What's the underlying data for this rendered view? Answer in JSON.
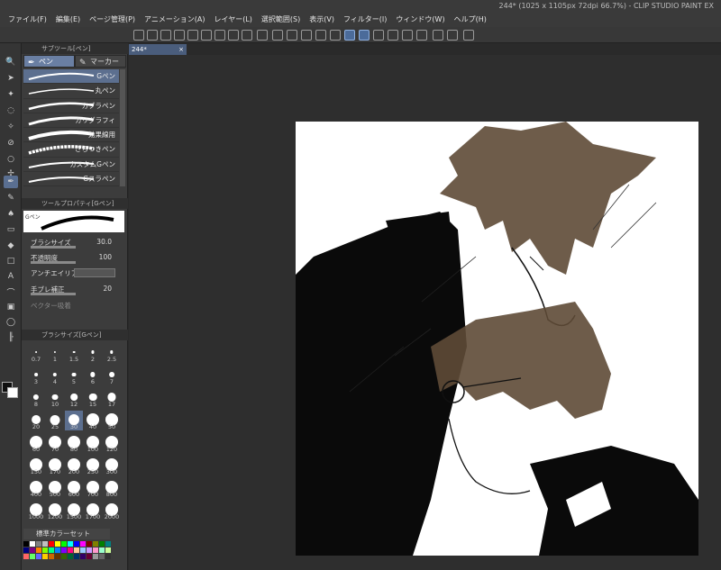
{
  "window": {
    "title": "244* (1025 x 1105px 72dpi 66.7%) - CLIP STUDIO PAINT EX"
  },
  "menu": [
    "ファイル(F)",
    "編集(E)",
    "ページ管理(P)",
    "アニメーション(A)",
    "レイヤー(L)",
    "選択範囲(S)",
    "表示(V)",
    "フィルター(I)",
    "ウィンドウ(W)",
    "ヘルプ(H)"
  ],
  "subtool_panel": {
    "header": "サブツール[ペン]",
    "tabs": [
      {
        "label": "ペン",
        "icon": "pen-icon",
        "active": true
      },
      {
        "label": "マーカー",
        "icon": "marker-icon",
        "active": false
      }
    ],
    "brushes": [
      {
        "name": "Gペン",
        "active": true
      },
      {
        "name": "丸ペン",
        "active": false
      },
      {
        "name": "カブラペン",
        "active": false
      },
      {
        "name": "カリグラフィ",
        "active": false
      },
      {
        "name": "効果線用",
        "active": false
      },
      {
        "name": "ざらつきペン",
        "active": false
      },
      {
        "name": "カスタムGペン",
        "active": false
      },
      {
        "name": "Gスラペン",
        "active": false
      }
    ]
  },
  "tool_property": {
    "header": "ツールプロパティ[Gペン]",
    "preview_label": "Gペン",
    "brush_size": {
      "label": "ブラシサイズ",
      "value": "30.0"
    },
    "opacity": {
      "label": "不透明度",
      "value": "100",
      "level": 1.0
    },
    "antialias": {
      "label": "アンチエイリアス"
    },
    "stabilization": {
      "label": "手ブレ補正",
      "value": "20"
    },
    "vector_snap": {
      "label": "ベクター吸着"
    }
  },
  "brush_size_panel": {
    "header": "ブラシサイズ[Gペン]",
    "sizes": [
      "0.7",
      "1",
      "1.5",
      "2",
      "2.5",
      "3",
      "4",
      "5",
      "6",
      "7",
      "8",
      "10",
      "12",
      "15",
      "17",
      "20",
      "25",
      "30",
      "40",
      "50",
      "60",
      "70",
      "80",
      "100",
      "120",
      "150",
      "170",
      "200",
      "250",
      "300",
      "400",
      "500",
      "600",
      "700",
      "800",
      "1000",
      "1200",
      "1500",
      "1700",
      "2000"
    ],
    "active": "30"
  },
  "color_set": {
    "label": "標準カラーセット"
  },
  "document_tab": {
    "label": "244*"
  },
  "colors": {
    "bg": "#2a2a2a",
    "panel": "#3c3c3c",
    "accent": "#5c6f8f",
    "hair": "#5e4a36",
    "ink": "#0a0a0a"
  }
}
